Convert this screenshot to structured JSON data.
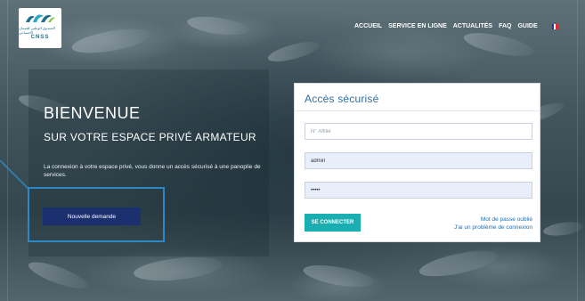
{
  "header": {
    "logo": {
      "arabic_text": "الصندوق الوطني للضمان الاجتماعي",
      "acronym": "CNSS",
      "colors": [
        "#1d6f8c",
        "#2aa8c4",
        "#8bc34a"
      ]
    },
    "nav": [
      {
        "label": "ACCUEIL"
      },
      {
        "label": "SERVICE EN LIGNE"
      },
      {
        "label": "ACTUALITÉS"
      },
      {
        "label": "FAQ"
      },
      {
        "label": "GUIDE"
      }
    ],
    "language_flag": {
      "icon": "french-flag-icon",
      "colors": [
        "#1f3c99",
        "#ffffff",
        "#e32636"
      ]
    }
  },
  "welcome": {
    "title": "BIENVENUE",
    "subtitle": "SUR VOTRE ESPACE PRIVÉ ARMATEUR",
    "intro": "La connexion à votre espace privé, vous donne un accès sécurisé à une panoplie de services.",
    "new_request_label": "Nouvelle demande"
  },
  "login": {
    "title": "Accès sécurisé",
    "affiliate_placeholder": "N° Affilié",
    "username_value": "admin",
    "password_value": "•••••",
    "submit_label": "SE CONNECTER",
    "forgot_password_label": "Mot de passe oublié",
    "connection_problem_label": "J'ai un problème de connexion"
  },
  "colors": {
    "accent_teal": "#19aeb2",
    "button_navy": "#1c2f6e",
    "highlight_blue": "#2d89c6",
    "title_blue": "#2f6fa4",
    "link_blue": "#1b6fb5"
  }
}
